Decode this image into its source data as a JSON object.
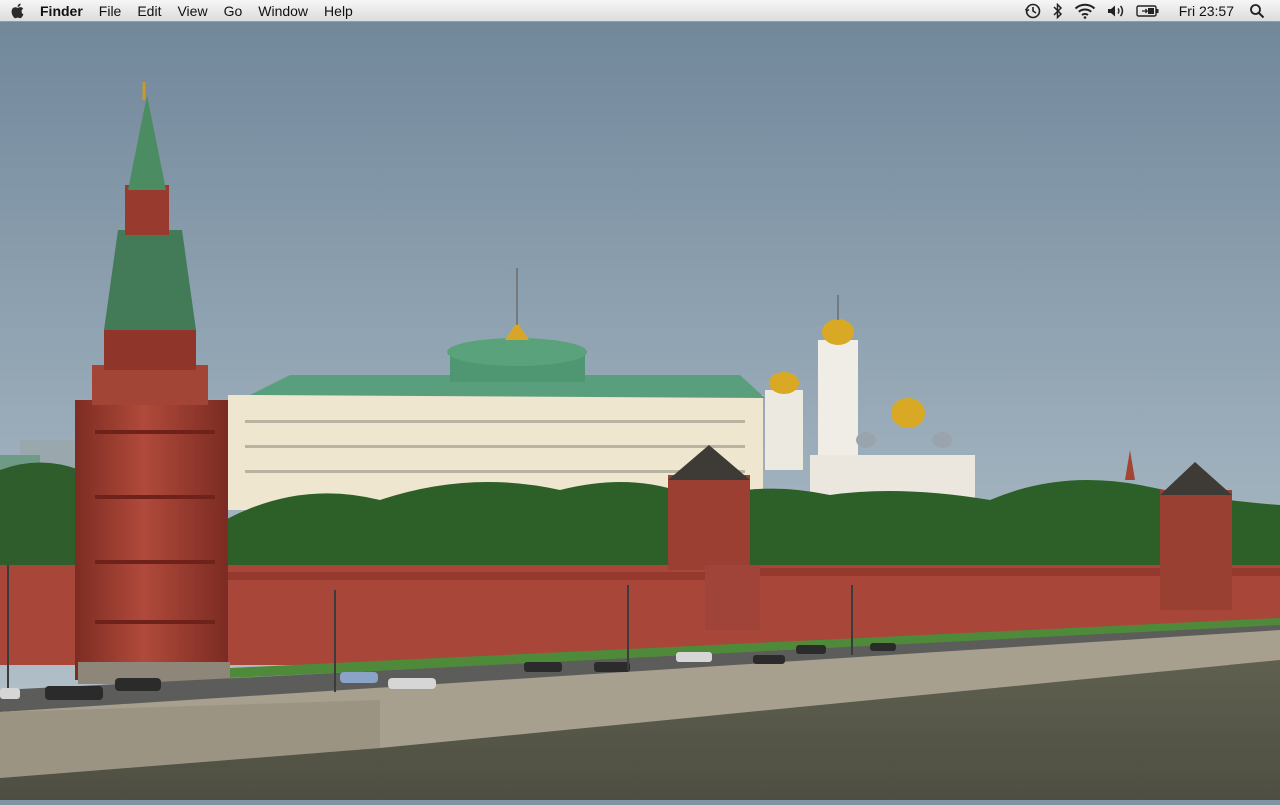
{
  "menubar": {
    "apple_icon": "apple-logo-icon",
    "app_name": "Finder",
    "menus": [
      "File",
      "Edit",
      "View",
      "Go",
      "Window",
      "Help"
    ],
    "status_icons": [
      "time-machine-icon",
      "bluetooth-icon",
      "wifi-icon",
      "volume-icon",
      "battery-icon"
    ],
    "clock": "Fri 23:57",
    "search_icon": "spotlight-search-icon"
  },
  "desktop": {
    "wallpaper": "Moscow Kremlin wall and towers along river embankment",
    "colors": {
      "sky": "#8fa2b1",
      "wall": "#a9463a",
      "river": "#5b5a4a",
      "roof_green": "#5aa27b",
      "gold": "#d9a925"
    }
  }
}
